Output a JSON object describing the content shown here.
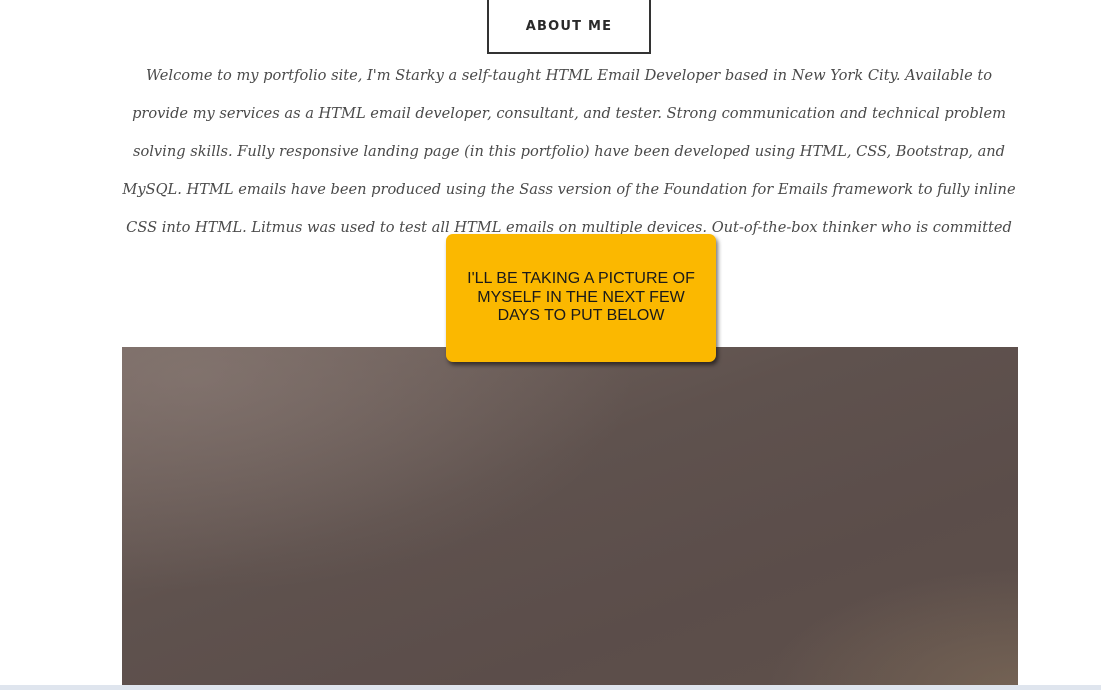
{
  "about": {
    "button_label": "ABOUT ME"
  },
  "bio": {
    "text": "Welcome to my portfolio site, I'm Starky a self-taught HTML Email Developer based in New York City. Available to provide my services as a HTML email developer, consultant, and tester. Strong communication and technical problem solving skills. Fully responsive landing page (in this portfolio) have been developed using HTML, CSS, Bootstrap, and MySQL. HTML emails have been produced using the Sass version of the Foundation for Emails framework to fully inline CSS into HTML. Litmus was used to test all HTML emails on multiple devices. Out-of-the-box thinker who is committed to exc"
  },
  "tooltip": {
    "text": "I'LL BE TAKING A PICTURE OF MYSELF IN THE NEXT FEW DAYS TO PUT BELOW",
    "background_color": "#fbb800"
  },
  "photo": {
    "description_color": "#5f524e"
  }
}
